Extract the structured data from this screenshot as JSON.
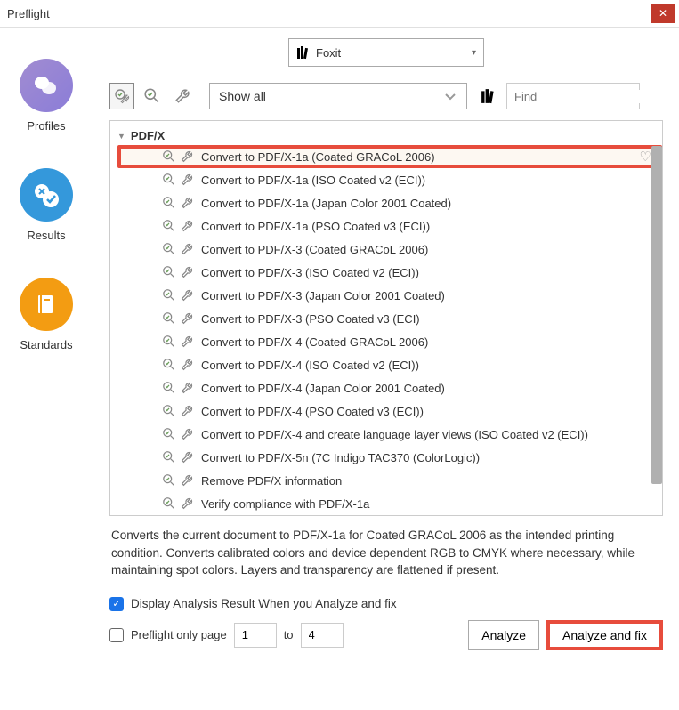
{
  "window": {
    "title": "Preflight"
  },
  "sidebar": {
    "items": [
      {
        "label": "Profiles"
      },
      {
        "label": "Results"
      },
      {
        "label": "Standards"
      }
    ]
  },
  "header": {
    "library_selected": "Foxit",
    "filter": "Show all",
    "search_placeholder": "Find"
  },
  "tree": {
    "group": "PDF/X",
    "items": [
      "Convert to PDF/X-1a (Coated GRACoL 2006)",
      "Convert to PDF/X-1a (ISO Coated v2 (ECI))",
      "Convert to PDF/X-1a (Japan Color 2001 Coated)",
      "Convert to PDF/X-1a (PSO Coated v3 (ECI))",
      "Convert to PDF/X-3 (Coated GRACoL 2006)",
      "Convert to PDF/X-3 (ISO Coated v2 (ECI))",
      "Convert to PDF/X-3 (Japan Color 2001 Coated)",
      "Convert to PDF/X-3 (PSO Coated v3 (ECI)",
      "Convert to PDF/X-4 (Coated GRACoL 2006)",
      "Convert to PDF/X-4 (ISO Coated v2 (ECI))",
      "Convert to PDF/X-4 (Japan Color 2001 Coated)",
      "Convert to PDF/X-4 (PSO Coated v3 (ECI))",
      "Convert to PDF/X-4 and create language layer views (ISO Coated v2 (ECI))",
      "Convert to PDF/X-5n (7C Indigo TAC370 (ColorLogic))",
      "Remove PDF/X information",
      "Verify compliance with PDF/X-1a"
    ]
  },
  "description": "Converts the current document to PDF/X-1a for Coated GRACoL 2006 as the intended printing condition. Converts calibrated colors and device dependent RGB to CMYK where necessary, while maintaining spot colors. Layers and transparency are flattened if present.",
  "options": {
    "display_result_label": "Display Analysis Result When you Analyze and fix",
    "preflight_only_label": "Preflight only page",
    "page_from": "1",
    "page_to_label": "to",
    "page_to": "4"
  },
  "actions": {
    "analyze": "Analyze",
    "analyze_fix": "Analyze and fix"
  }
}
